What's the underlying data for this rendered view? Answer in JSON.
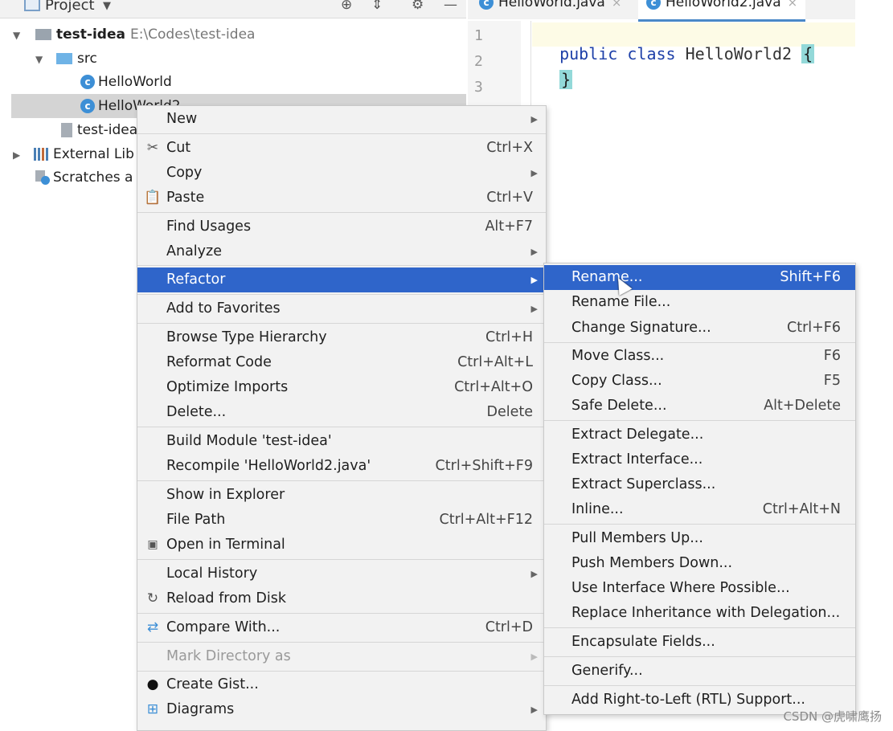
{
  "project_panel": {
    "title": "Project",
    "header_icons": [
      "locate-icon",
      "collapse-icon",
      "gear-icon",
      "minimize-icon"
    ]
  },
  "tree": {
    "root_name": "test-idea",
    "root_path": "E:\\Codes\\test-idea",
    "src": "src",
    "file1": "HelloWorld",
    "file2": "HelloWorld2",
    "iml": "test-idea",
    "external_libs": "External Lib",
    "scratches": "Scratches a"
  },
  "editor": {
    "tab1": "HelloWorld.java",
    "tab2": "HelloWorld2.java",
    "tab_close": "×",
    "line_numbers": [
      "1",
      "2",
      "3"
    ],
    "code_line1_kw": "public class",
    "code_line1_name": "HelloWorld2",
    "code_line1_brace": "{",
    "code_line2": "}"
  },
  "main_menu": [
    {
      "label": "New",
      "shortcut": "",
      "submenu": true
    },
    {
      "label": "Cut",
      "shortcut": "Ctrl+X",
      "icon": "scissors-icon"
    },
    {
      "label": "Copy",
      "shortcut": "",
      "submenu": true
    },
    {
      "label": "Paste",
      "shortcut": "Ctrl+V",
      "icon": "clipboard-icon"
    },
    {
      "label": "Find Usages",
      "shortcut": "Alt+F7"
    },
    {
      "label": "Analyze",
      "shortcut": "",
      "submenu": true
    },
    {
      "label": "Refactor",
      "shortcut": "",
      "submenu": true,
      "active": true
    },
    {
      "label": "Add to Favorites",
      "shortcut": "",
      "submenu": true
    },
    {
      "label": "Browse Type Hierarchy",
      "shortcut": "Ctrl+H"
    },
    {
      "label": "Reformat Code",
      "shortcut": "Ctrl+Alt+L"
    },
    {
      "label": "Optimize Imports",
      "shortcut": "Ctrl+Alt+O"
    },
    {
      "label": "Delete...",
      "shortcut": "Delete"
    },
    {
      "label": "Build Module 'test-idea'",
      "shortcut": ""
    },
    {
      "label": "Recompile 'HelloWorld2.java'",
      "shortcut": "Ctrl+Shift+F9"
    },
    {
      "label": "Show in Explorer",
      "shortcut": ""
    },
    {
      "label": "File Path",
      "shortcut": "Ctrl+Alt+F12"
    },
    {
      "label": "Open in Terminal",
      "shortcut": "",
      "icon": "terminal-icon"
    },
    {
      "label": "Local History",
      "shortcut": "",
      "submenu": true
    },
    {
      "label": "Reload from Disk",
      "shortcut": "",
      "icon": "reload-icon"
    },
    {
      "label": "Compare With...",
      "shortcut": "Ctrl+D",
      "icon": "compare-icon"
    },
    {
      "label": "Mark Directory as",
      "shortcut": "",
      "submenu": true,
      "disabled": true
    },
    {
      "label": "Create Gist...",
      "shortcut": "",
      "icon": "github-icon"
    },
    {
      "label": "Diagrams",
      "shortcut": "",
      "submenu": true,
      "icon": "diagram-icon"
    }
  ],
  "refactor_menu": [
    {
      "label": "Rename...",
      "shortcut": "Shift+F6",
      "active": true
    },
    {
      "label": "Rename File...",
      "shortcut": ""
    },
    {
      "label": "Change Signature...",
      "shortcut": "Ctrl+F6"
    },
    {
      "label": "Move Class...",
      "shortcut": "F6"
    },
    {
      "label": "Copy Class...",
      "shortcut": "F5"
    },
    {
      "label": "Safe Delete...",
      "shortcut": "Alt+Delete"
    },
    {
      "label": "Extract Delegate...",
      "shortcut": ""
    },
    {
      "label": "Extract Interface...",
      "shortcut": ""
    },
    {
      "label": "Extract Superclass...",
      "shortcut": ""
    },
    {
      "label": "Inline...",
      "shortcut": "Ctrl+Alt+N"
    },
    {
      "label": "Pull Members Up...",
      "shortcut": ""
    },
    {
      "label": "Push Members Down...",
      "shortcut": ""
    },
    {
      "label": "Use Interface Where Possible...",
      "shortcut": ""
    },
    {
      "label": "Replace Inheritance with Delegation...",
      "shortcut": ""
    },
    {
      "label": "Encapsulate Fields...",
      "shortcut": ""
    },
    {
      "label": "Generify...",
      "shortcut": ""
    },
    {
      "label": "Add Right-to-Left (RTL) Support...",
      "shortcut": ""
    }
  ],
  "colors": {
    "menu_bg": "#f2f2f2",
    "active_bg": "#2f65ca",
    "selection_bg": "#d4d4d4",
    "keyword": "#1d3fa8"
  },
  "watermark": "CSDN @虎啸鹰扬"
}
